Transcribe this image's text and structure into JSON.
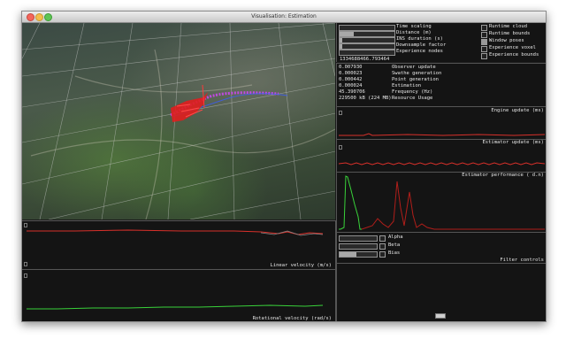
{
  "window": {
    "title": "Visualisation: Estimation"
  },
  "left_panel": {
    "linear_velocity_label": "Linear velocity (m/s)",
    "rotational_velocity_label": "Rotational velocity (rad/s)"
  },
  "controls": {
    "sliders": [
      {
        "label": "Time scaling",
        "value": 0.0
      },
      {
        "label": "Distance (m)",
        "value": 0.25
      },
      {
        "label": "INS duration (s)",
        "value": 0.05
      },
      {
        "label": "Downsample factor",
        "value": 0.05
      },
      {
        "label": "Experience nodes",
        "value": 0.0
      }
    ],
    "timestamp": "1334688466.793464",
    "checkboxes": [
      {
        "label": "Runtime cloud",
        "checked": false
      },
      {
        "label": "Runtime bounds",
        "checked": false
      },
      {
        "label": "Window poses",
        "checked": true
      },
      {
        "label": "Experience voxel",
        "checked": false
      },
      {
        "label": "Experience bounds",
        "checked": false
      }
    ]
  },
  "stats": [
    {
      "value": "0.007930",
      "label": "Observer update"
    },
    {
      "value": "0.000023",
      "label": "Swathe generation"
    },
    {
      "value": "0.000442",
      "label": "Point generation"
    },
    {
      "value": "0.000024",
      "label": "Estimation"
    },
    {
      "value": "45.390706",
      "label": "Frequency (Hz)"
    },
    {
      "value": "229500 kB (224 MB)",
      "label": "Resource Usage"
    }
  ],
  "plots": {
    "engine_update": "Engine update (ms)",
    "estimator_update": "Estimator update (ms)",
    "estimator_performance": "Estimator performance ( d.n)"
  },
  "filter": {
    "title": "Filter controls",
    "sliders": [
      {
        "label": "Alpha",
        "value": 0.0
      },
      {
        "label": "Beta",
        "value": 0.0
      },
      {
        "label": "Bias",
        "value": 0.45
      }
    ]
  },
  "colors": {
    "trace_red": "#d8302a",
    "trace_green": "#39d23a",
    "background": "#141414"
  }
}
